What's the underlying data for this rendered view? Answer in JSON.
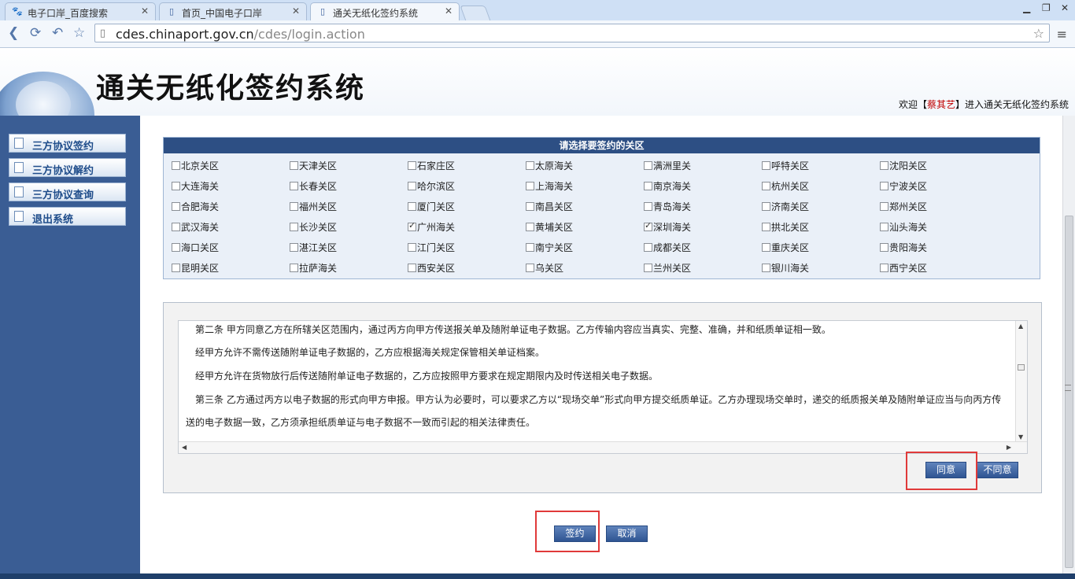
{
  "browser": {
    "tabs": [
      {
        "title": "电子口岸_百度搜索",
        "icon": "baidu-paw-icon"
      },
      {
        "title": "首页_中国电子口岸",
        "icon": "page-icon"
      },
      {
        "title": "通关无纸化签约系统",
        "icon": "page-icon",
        "active": true
      }
    ],
    "url_host": "cdes.chinaport.gov.cn",
    "url_path": "/cdes/login.action"
  },
  "header": {
    "title": "通关无纸化签约系统",
    "welcome_prefix": "欢迎【",
    "user": "蔡其艺",
    "welcome_suffix": "】进入通关无纸化签约系统"
  },
  "sidebar": {
    "items": [
      {
        "label": "三方协议签约"
      },
      {
        "label": "三方协议解约"
      },
      {
        "label": "三方协议查询"
      },
      {
        "label": "退出系统"
      }
    ]
  },
  "customs": {
    "heading": "请选择要签约的关区",
    "rows": [
      [
        {
          "label": "北京关区",
          "checked": false
        },
        {
          "label": "天津关区",
          "checked": false
        },
        {
          "label": "石家庄区",
          "checked": false
        },
        {
          "label": "太原海关",
          "checked": false
        },
        {
          "label": "满洲里关",
          "checked": false
        },
        {
          "label": "呼特关区",
          "checked": false
        },
        {
          "label": "沈阳关区",
          "checked": false
        }
      ],
      [
        {
          "label": "大连海关",
          "checked": false
        },
        {
          "label": "长春关区",
          "checked": false
        },
        {
          "label": "哈尔滨区",
          "checked": false
        },
        {
          "label": "上海海关",
          "checked": false
        },
        {
          "label": "南京海关",
          "checked": false
        },
        {
          "label": "杭州关区",
          "checked": false
        },
        {
          "label": "宁波关区",
          "checked": false
        }
      ],
      [
        {
          "label": "合肥海关",
          "checked": false
        },
        {
          "label": "福州关区",
          "checked": false
        },
        {
          "label": "厦门关区",
          "checked": false
        },
        {
          "label": "南昌关区",
          "checked": false
        },
        {
          "label": "青岛海关",
          "checked": false
        },
        {
          "label": "济南关区",
          "checked": false
        },
        {
          "label": "郑州关区",
          "checked": false
        }
      ],
      [
        {
          "label": "武汉海关",
          "checked": false
        },
        {
          "label": "长沙关区",
          "checked": false
        },
        {
          "label": "广州海关",
          "checked": true
        },
        {
          "label": "黄埔关区",
          "checked": false
        },
        {
          "label": "深圳海关",
          "checked": true
        },
        {
          "label": "拱北关区",
          "checked": false
        },
        {
          "label": "汕头海关",
          "checked": false
        }
      ],
      [
        {
          "label": "海口关区",
          "checked": false
        },
        {
          "label": "湛江关区",
          "checked": false
        },
        {
          "label": "江门关区",
          "checked": false
        },
        {
          "label": "南宁关区",
          "checked": false
        },
        {
          "label": "成都关区",
          "checked": false
        },
        {
          "label": "重庆关区",
          "checked": false
        },
        {
          "label": "贵阳海关",
          "checked": false
        }
      ],
      [
        {
          "label": "昆明关区",
          "checked": false
        },
        {
          "label": "拉萨海关",
          "checked": false
        },
        {
          "label": "西安关区",
          "checked": false
        },
        {
          "label": "乌关区",
          "checked": false
        },
        {
          "label": "兰州关区",
          "checked": false
        },
        {
          "label": "银川海关",
          "checked": false
        },
        {
          "label": "西宁关区",
          "checked": false
        }
      ]
    ]
  },
  "terms": {
    "paragraphs": [
      "第二条 甲方同意乙方在所辖关区范围内，通过丙方向甲方传送报关单及随附单证电子数据。乙方传输内容应当真实、完整、准确，并和纸质单证相一致。",
      "经甲方允许不需传送随附单证电子数据的，乙方应根据海关规定保管相关单证档案。",
      "经甲方允许在货物放行后传送随附单证电子数据的，乙方应按照甲方要求在规定期限内及时传送相关电子数据。",
      "第三条 乙方通过丙方以电子数据的形式向甲方申报。甲方认为必要时，可以要求乙方以“现场交单”形式向甲方提交纸质单证。乙方办理现场交单时，递交的纸质报关单及随附单证应当与向丙方传",
      "送的电子数据一致，乙方须承担纸质单证与电子数据不一致而引起的相关法律责任。"
    ],
    "agree_label": "同意",
    "disagree_label": "不同意"
  },
  "actions": {
    "sign_label": "签约",
    "cancel_label": "取消"
  },
  "colors": {
    "sidebar_bg": "#3a5d94",
    "panel_header": "#2d4f84",
    "button": "#2f5593",
    "highlight": "#e03a3a",
    "user_name": "#c00000"
  }
}
